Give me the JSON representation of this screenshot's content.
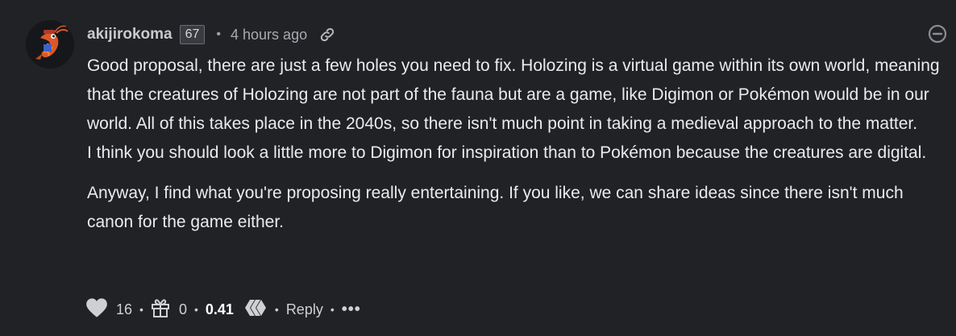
{
  "comment": {
    "author": "akijirokoma",
    "reputation": "67",
    "time": "4 hours ago",
    "paragraphs": [
      "Good proposal, there are just a few holes you need to fix. Holozing is a virtual game within its own world, meaning that the creatures of Holozing are not part of the fauna but are a game, like Digimon or Pokémon would be in our world. All of this takes place in the 2040s, so there isn't much point in taking a medieval approach to the matter.",
      "I think you should look a little more to Digimon for inspiration than to Pokémon because the creatures are digital.",
      "Anyway, I find what you're proposing really entertaining. If you like, we can share ideas since there isn't much canon for the game either."
    ],
    "footer": {
      "votes": "16",
      "gifts": "0",
      "payout": "0.41",
      "reply_label": "Reply",
      "more_label": "•••"
    }
  },
  "icons": {
    "link": "link-icon",
    "collapse": "collapse-icon",
    "heart": "heart-icon",
    "gift": "gift-icon",
    "hive": "hive-icon"
  },
  "colors": {
    "background": "#212226",
    "text": "#ebebec",
    "muted": "#a8aaaf"
  }
}
